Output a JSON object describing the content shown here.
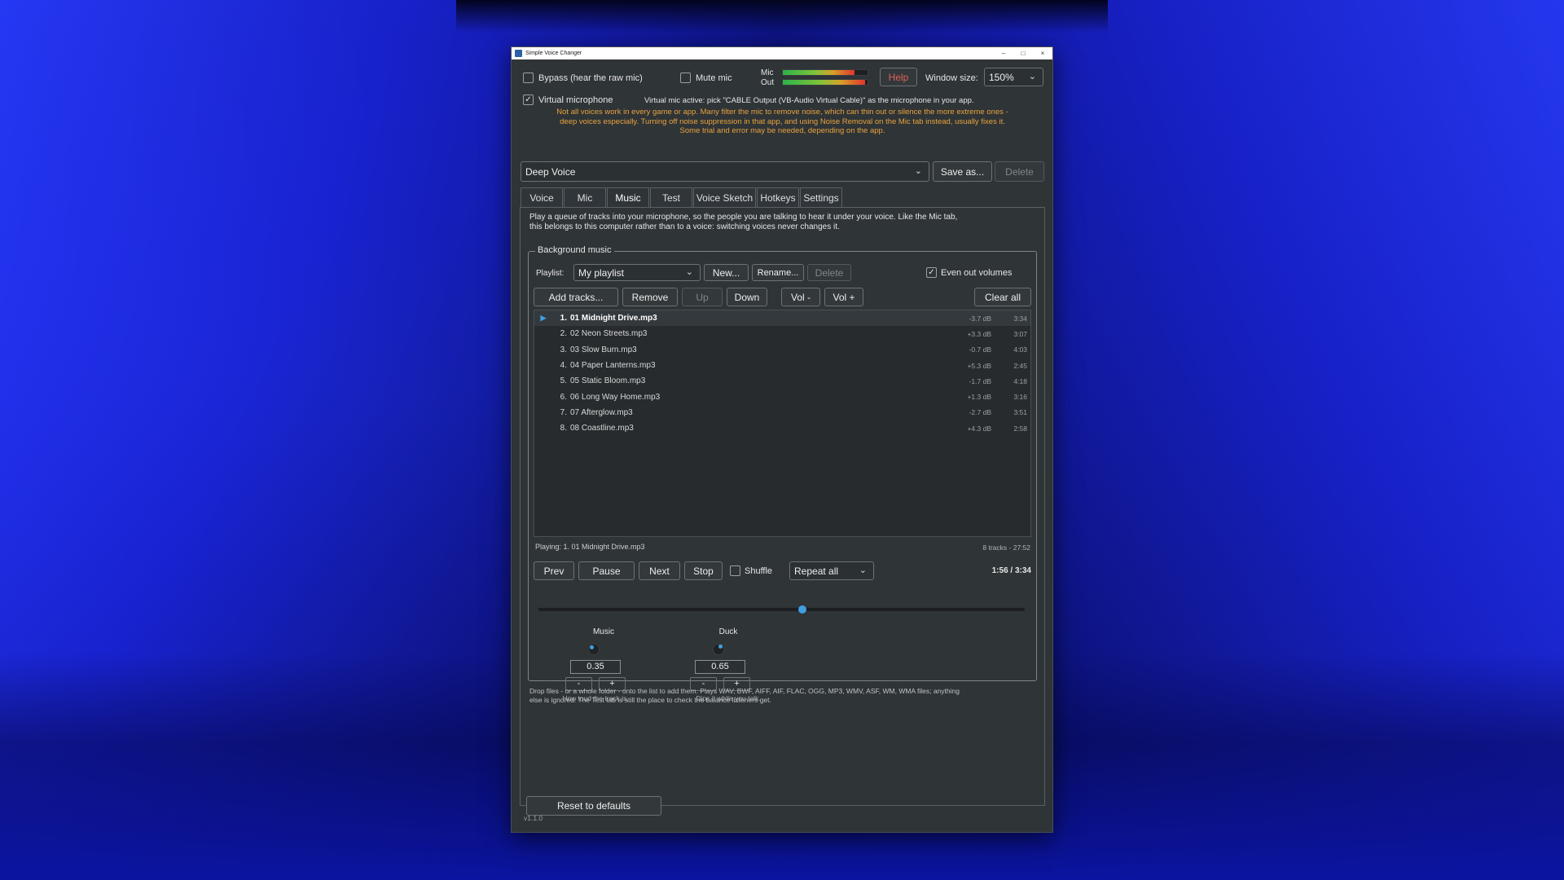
{
  "window": {
    "title": "Simple Voice Changer",
    "minimize": "–",
    "maximize": "□",
    "close": "×"
  },
  "top": {
    "bypass_label": "Bypass (hear the raw mic)",
    "bypass_checked": false,
    "mute_label": "Mute mic",
    "mute_checked": false,
    "mic_label": "Mic",
    "out_label": "Out",
    "mic_level": 0.85,
    "out_level": 0.97,
    "help_label": "Help",
    "window_size_label": "Window size:",
    "window_size_value": "150%",
    "virtual_mic_label": "Virtual microphone",
    "virtual_mic_checked": true,
    "virtual_mic_status": "Virtual mic active: pick \"CABLE Output (VB-Audio Virtual Cable)\" as the microphone in your app.",
    "notice_line1": "Not all voices work in every game or app. Many filter the mic to remove noise, which can thin out or silence the more extreme ones -",
    "notice_line2": "deep voices especially. Turning off noise suppression in that app, and using Noise Removal on the Mic tab instead, usually fixes it.",
    "notice_line3": "Some trial and error may be needed, depending on the app."
  },
  "preset": {
    "value": "Deep Voice",
    "save_as": "Save as...",
    "delete": "Delete"
  },
  "tabs": [
    "Voice",
    "Mic",
    "Music",
    "Test",
    "Voice Sketch",
    "Hotkeys",
    "Settings"
  ],
  "active_tab": "Music",
  "music": {
    "intro_line1": "Play a queue of tracks into your microphone, so the people you are talking to hear it under your voice. Like the Mic tab,",
    "intro_line2": "this belongs to this computer rather than to a voice: switching voices never changes it.",
    "group_title": "Background music",
    "playlist_label": "Playlist:",
    "playlist_value": "My playlist",
    "new_label": "New...",
    "rename_label": "Rename...",
    "delete_label": "Delete",
    "even_out_label": "Even out volumes",
    "even_out_checked": true,
    "add_tracks": "Add tracks...",
    "remove": "Remove",
    "up": "Up",
    "down": "Down",
    "vol_minus": "Vol -",
    "vol_plus": "Vol +",
    "clear_all": "Clear all",
    "tracks": [
      {
        "num": "1.",
        "name": "01 Midnight Drive.mp3",
        "gain": "-3.7 dB",
        "dur": "3:34"
      },
      {
        "num": "2.",
        "name": "02 Neon Streets.mp3",
        "gain": "+3.3 dB",
        "dur": "3:07"
      },
      {
        "num": "3.",
        "name": "03 Slow Burn.mp3",
        "gain": "-0.7 dB",
        "dur": "4:03"
      },
      {
        "num": "4.",
        "name": "04 Paper Lanterns.mp3",
        "gain": "+5.3 dB",
        "dur": "2:45"
      },
      {
        "num": "5.",
        "name": "05 Static Bloom.mp3",
        "gain": "-1.7 dB",
        "dur": "4:18"
      },
      {
        "num": "6.",
        "name": "06 Long Way Home.mp3",
        "gain": "+1.3 dB",
        "dur": "3:16"
      },
      {
        "num": "7.",
        "name": "07 Afterglow.mp3",
        "gain": "-2.7 dB",
        "dur": "3:51"
      },
      {
        "num": "8.",
        "name": "08 Coastline.mp3",
        "gain": "+4.3 dB",
        "dur": "2:58"
      }
    ],
    "playing_index": 0,
    "playing_marker": "▶",
    "now_playing": "Playing: 1. 01 Midnight Drive.mp3",
    "summary": "8 tracks - 27:52",
    "prev": "Prev",
    "pause": "Pause",
    "next": "Next",
    "stop": "Stop",
    "shuffle_label": "Shuffle",
    "shuffle_checked": false,
    "repeat_value": "Repeat all",
    "time": "1:56 / 3:34",
    "progress": 0.542,
    "music_knob_label": "Music",
    "music_value": "0.35",
    "music_hint": "How loud the track is.",
    "duck_knob_label": "Duck",
    "duck_value": "0.65",
    "duck_hint": "Dips it while you talk.",
    "minus": "-",
    "plus": "+",
    "drop_line1": "Drop files - or a whole folder - onto the list to add them. Plays WAV, BWF, AIFF, AIF, FLAC, OGG, MP3, WMV, ASF, WM, WMA files; anything",
    "drop_line2": "else is ignored. The Test tab is still the place to check the balance listeners get.",
    "reset": "Reset to defaults"
  },
  "version": "v1.1.0",
  "colors": {
    "accent": "#3fa0e0",
    "warning": "#e8a33d",
    "help": "#e0605a"
  }
}
